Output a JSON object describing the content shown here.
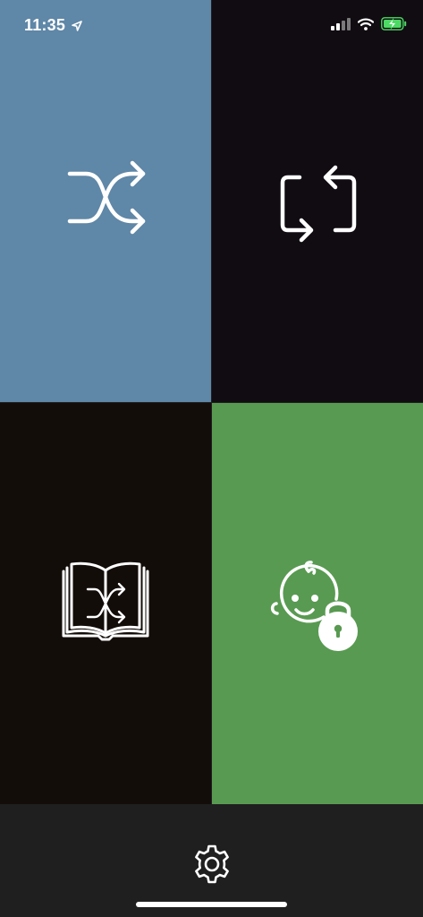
{
  "status_bar": {
    "time": "11:35",
    "location_icon": "location-arrow-icon",
    "signal_icon": "cellular-signal-icon",
    "wifi_icon": "wifi-icon",
    "battery_icon": "battery-charging-icon"
  },
  "tiles": [
    {
      "name": "shuffle",
      "icon": "shuffle-icon",
      "color": "#5f87a7"
    },
    {
      "name": "repeat",
      "icon": "repeat-icon",
      "color": "#110c12"
    },
    {
      "name": "story-shuffle",
      "icon": "book-shuffle-icon",
      "color": "#130d0a"
    },
    {
      "name": "kid-lock",
      "icon": "baby-lock-icon",
      "color": "#589a51"
    }
  ],
  "bottom_bar": {
    "settings_icon": "gear-icon",
    "background": "#1f1f1f"
  },
  "colors": {
    "icon": "#ffffff",
    "battery_charge": "#4cd964"
  }
}
